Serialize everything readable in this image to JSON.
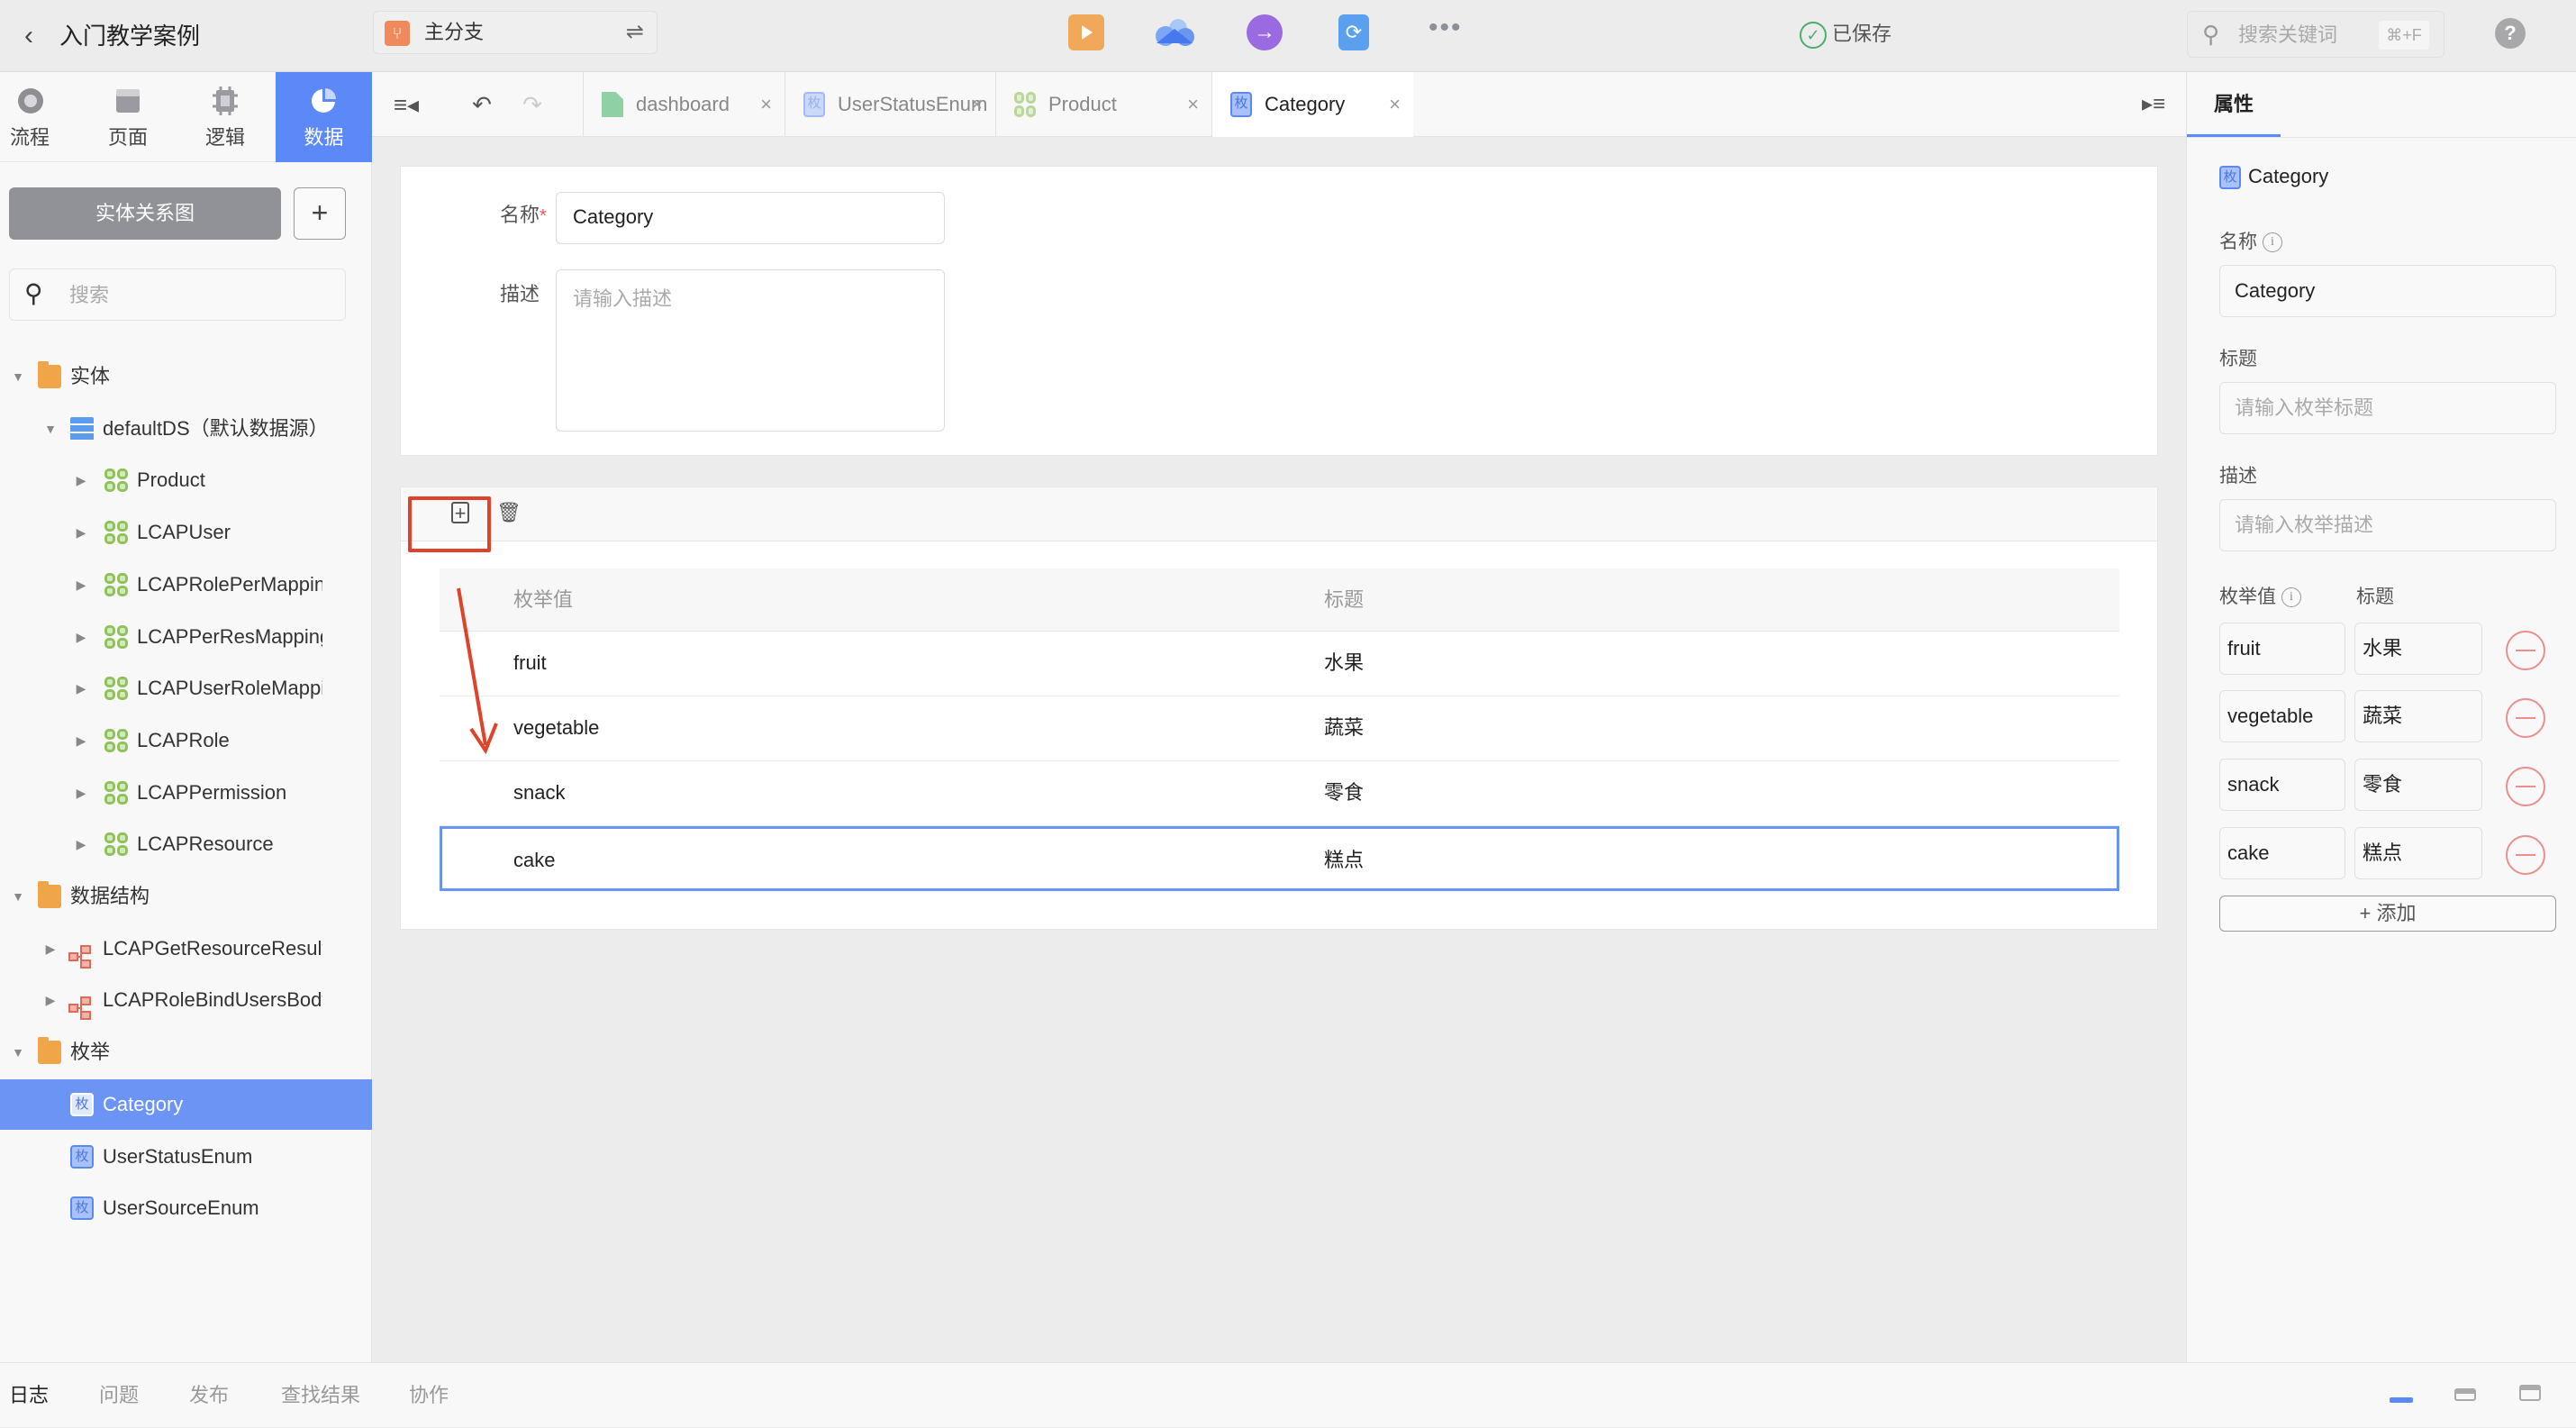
{
  "topbar": {
    "back_icon": "chevron-left-icon",
    "project_title": "入门教学案例",
    "branch": {
      "icon": "git-branch-icon",
      "label": "主分支",
      "switch_icon": "swap-icon"
    },
    "tools": [
      {
        "name": "preview",
        "icon": "play-icon"
      },
      {
        "name": "deploy-cloud",
        "icon": "cloud-icon"
      },
      {
        "name": "publish",
        "icon": "arrow-right-circle-icon"
      },
      {
        "name": "sync",
        "icon": "sync-file-icon"
      },
      {
        "name": "more",
        "icon": "more-icon",
        "label": "•••"
      }
    ],
    "save_status": "已保存",
    "search": {
      "placeholder": "搜索关键词",
      "shortcut": "⌘+F"
    },
    "help_label": "?"
  },
  "sidebar": {
    "nav_tabs": [
      {
        "label": "流程",
        "icon": "flow-icon",
        "active": false
      },
      {
        "label": "页面",
        "icon": "page-icon",
        "active": false
      },
      {
        "label": "逻辑",
        "icon": "logic-chip-icon",
        "active": false
      },
      {
        "label": "数据",
        "icon": "pie-chart-icon",
        "active": true
      }
    ],
    "er_button": "实体关系图",
    "add_button": "+",
    "search_placeholder": "搜索",
    "tree": [
      {
        "label": "实体",
        "type": "folder",
        "level": 0,
        "expanded": true
      },
      {
        "label": "defaultDS（默认数据源）",
        "type": "datasource",
        "level": 1,
        "expanded": true
      },
      {
        "label": "Product",
        "type": "entity",
        "level": 2
      },
      {
        "label": "LCAPUser",
        "type": "entity",
        "level": 2
      },
      {
        "label": "LCAPRolePerMapping",
        "type": "entity",
        "level": 2
      },
      {
        "label": "LCAPPerResMapping",
        "type": "entity",
        "level": 2
      },
      {
        "label": "LCAPUserRoleMapping",
        "type": "entity",
        "level": 2
      },
      {
        "label": "LCAPRole",
        "type": "entity",
        "level": 2
      },
      {
        "label": "LCAPPermission",
        "type": "entity",
        "level": 2
      },
      {
        "label": "LCAPResource",
        "type": "entity",
        "level": 2
      },
      {
        "label": "数据结构",
        "type": "folder",
        "level": 0,
        "expanded": true
      },
      {
        "label": "LCAPGetResourceResult",
        "type": "structure",
        "level": 1
      },
      {
        "label": "LCAPRoleBindUsersBody",
        "type": "structure",
        "level": 1
      },
      {
        "label": "枚举",
        "type": "folder",
        "level": 0,
        "expanded": true
      },
      {
        "label": "Category",
        "type": "enum",
        "level": 1,
        "selected": true
      },
      {
        "label": "UserStatusEnum",
        "type": "enum",
        "level": 1
      },
      {
        "label": "UserSourceEnum",
        "type": "enum",
        "level": 1
      }
    ]
  },
  "editor": {
    "toolbar": {
      "collapse_icon": "collapse-left-icon",
      "undo_icon": "undo-icon",
      "redo_icon": "redo-icon",
      "expand_icon": "collapse-right-icon"
    },
    "tabs": [
      {
        "label": "dashboard",
        "icon": "file-icon",
        "active": false
      },
      {
        "label": "UserStatusEnum",
        "icon": "enum-icon",
        "active": false
      },
      {
        "label": "Product",
        "icon": "entity-icon",
        "active": false
      },
      {
        "label": "Category",
        "icon": "enum-icon",
        "active": true
      }
    ],
    "close_glyph": "×",
    "enum_glyph": "枚",
    "form": {
      "name_label": "名称",
      "required_mark": "*",
      "name_value": "Category",
      "desc_label": "描述",
      "desc_placeholder": "请输入描述"
    },
    "table": {
      "add_icon": "add-square-icon",
      "delete_icon": "trash-icon",
      "columns": [
        "枚举值",
        "标题"
      ],
      "rows": [
        {
          "value": "fruit",
          "title": "水果"
        },
        {
          "value": "vegetable",
          "title": "蔬菜"
        },
        {
          "value": "snack",
          "title": "零食"
        },
        {
          "value": "cake",
          "title": "糕点",
          "selected": true
        }
      ]
    },
    "annotation": {
      "highlight_color": "#e0432b",
      "arrow_color": "#e0432b"
    }
  },
  "properties": {
    "tab_label": "属性",
    "header": "Category",
    "name_label": "名称",
    "name_value": "Category",
    "title_label": "标题",
    "title_placeholder": "请输入枚举标题",
    "desc_label": "描述",
    "desc_placeholder": "请输入枚举描述",
    "enum_value_label": "枚举值",
    "enum_title_label": "标题",
    "items": [
      {
        "value": "fruit",
        "title": "水果"
      },
      {
        "value": "vegetable",
        "title": "蔬菜"
      },
      {
        "value": "snack",
        "title": "零食"
      },
      {
        "value": "cake",
        "title": "糕点"
      }
    ],
    "add_label": "+ 添加"
  },
  "bottombar": {
    "tabs": [
      {
        "label": "日志",
        "active": true
      },
      {
        "label": "问题",
        "active": false
      },
      {
        "label": "发布",
        "active": false
      },
      {
        "label": "查找结果",
        "active": false
      },
      {
        "label": "协作",
        "active": false
      }
    ],
    "layout_icons": [
      "layout-minimized-icon",
      "layout-half-icon",
      "layout-full-icon"
    ]
  },
  "colors": {
    "accent": "#5b89f7",
    "saved": "#4cae6e",
    "danger": "#ea8e8e",
    "branch": "#f08a5d"
  }
}
